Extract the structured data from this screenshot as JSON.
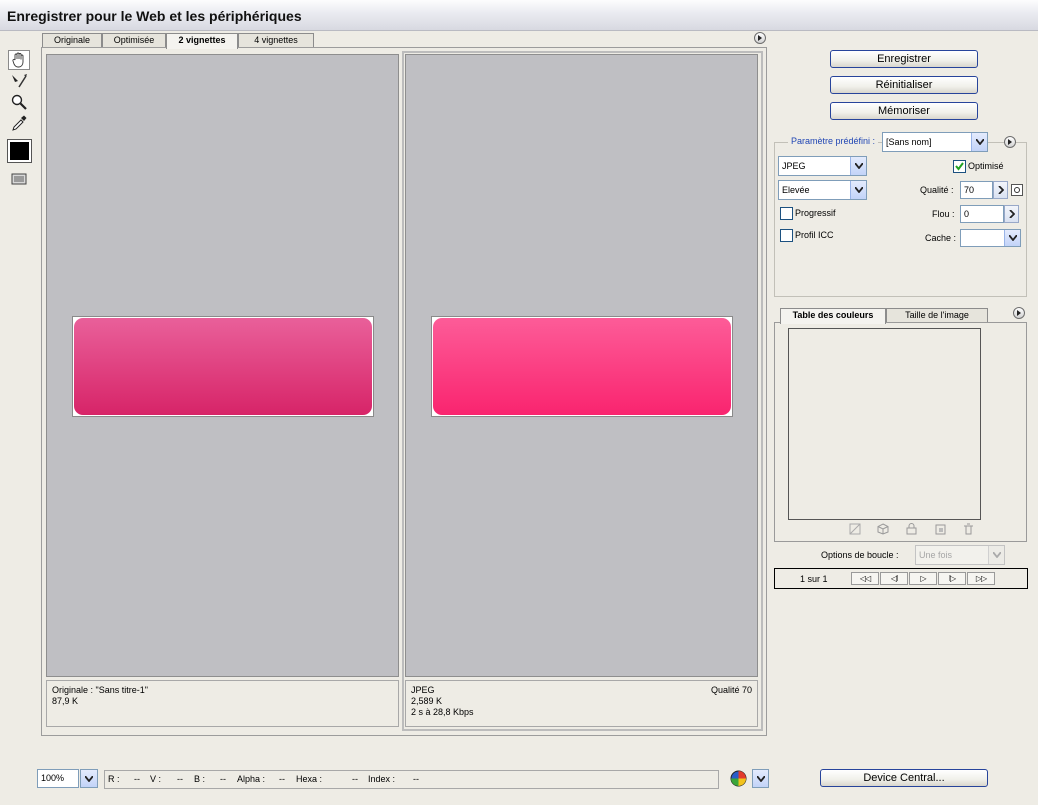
{
  "window": {
    "title": "Enregistrer pour le Web et les périphériques"
  },
  "tabs": [
    {
      "label": "Originale"
    },
    {
      "label": "Optimisée"
    },
    {
      "label": "2 vignettes"
    },
    {
      "label": "4 vignettes"
    }
  ],
  "panes": {
    "original": {
      "line1": "Originale : \"Sans titre-1\"",
      "line2": "87,9 K"
    },
    "optimized": {
      "format": "JPEG",
      "quality": "Qualité 70",
      "size": "2,589 K",
      "time": "2 s à 28,8 Kbps"
    }
  },
  "buttons": {
    "save": "Enregistrer",
    "reset": "Réinitialiser",
    "remember": "Mémoriser",
    "device_central": "Device Central..."
  },
  "settings": {
    "preset_label": "Paramètre prédéfini :",
    "preset_value": "[Sans nom]",
    "format_value": "JPEG",
    "quality_preset_value": "Elevée",
    "optimized_label": "Optimisé",
    "optimized_checked": true,
    "quality_label": "Qualité :",
    "quality_value": "70",
    "progressive_label": "Progressif",
    "progressive_checked": false,
    "blur_label": "Flou :",
    "blur_value": "0",
    "icc_label": "Profil ICC",
    "icc_checked": false,
    "matte_label": "Cache :",
    "matte_value": ""
  },
  "subtabs": [
    {
      "label": "Table des couleurs"
    },
    {
      "label": "Taille de l'image"
    }
  ],
  "animation": {
    "loop_label": "Options de boucle :",
    "loop_value": "Une fois",
    "frame_counter": "1 sur 1"
  },
  "status_bar": {
    "zoom": "100%",
    "r_label": "R :",
    "r_value": "--",
    "v_label": "V :",
    "v_value": "--",
    "b_label": "B :",
    "b_value": "--",
    "alpha_label": "Alpha :",
    "alpha_value": "--",
    "hexa_label": "Hexa :",
    "hexa_value": "--",
    "index_label": "Index :",
    "index_value": "--"
  },
  "colors": {
    "original_button": "#d72468",
    "optimized_button": "#f9246f",
    "pane_background": "#bfbfc3",
    "dialog_background": "#eeece5",
    "button_border": "#27449b"
  }
}
